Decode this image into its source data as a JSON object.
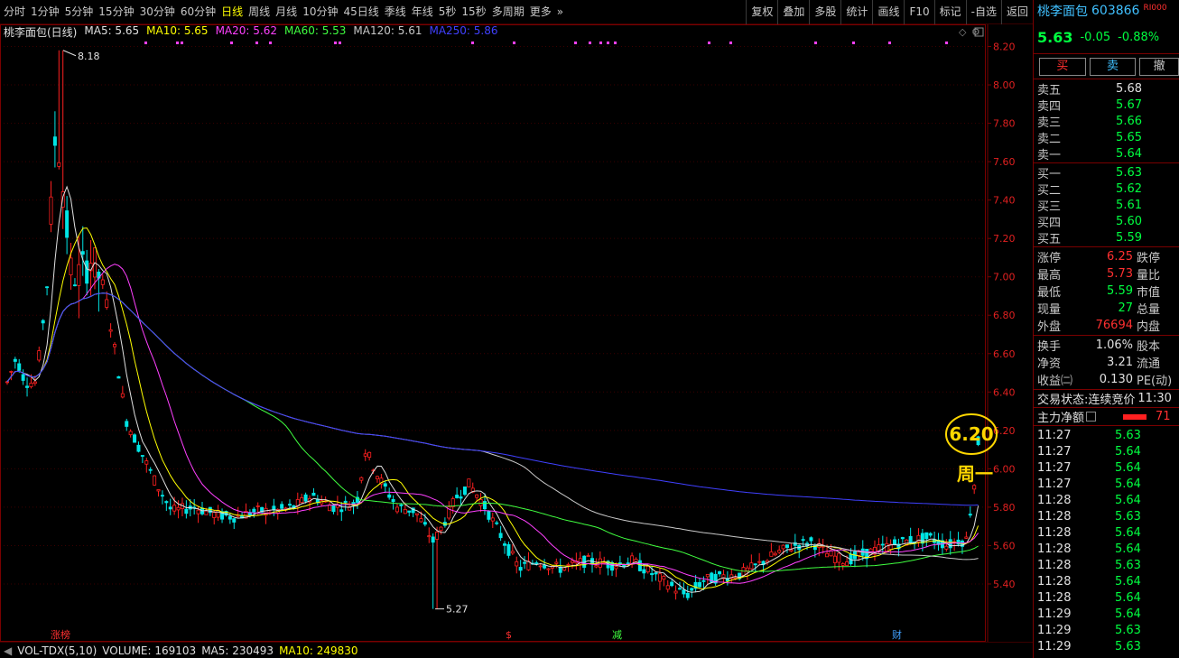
{
  "toolbar": {
    "periods": [
      "分时",
      "1分钟",
      "5分钟",
      "15分钟",
      "30分钟",
      "60分钟",
      "日线",
      "周线",
      "月线",
      "10分钟",
      "45日线",
      "季线",
      "年线",
      "5秒",
      "15秒",
      "多周期",
      "更多"
    ],
    "active_period": "日线",
    "more_arrow": "»",
    "tools": [
      "复权",
      "叠加",
      "多股",
      "统计",
      "画线",
      "F10",
      "标记",
      "-自选",
      "返回"
    ]
  },
  "legend": {
    "stock": "桃李面包(日线)",
    "ma": [
      {
        "label": "MA5: 5.65",
        "color": "#e0e0e0"
      },
      {
        "label": "MA10: 5.65",
        "color": "#ffff00"
      },
      {
        "label": "MA20: 5.62",
        "color": "#ff40ff"
      },
      {
        "label": "MA60: 5.53",
        "color": "#40ff40"
      },
      {
        "label": "MA120: 5.61",
        "color": "#c8c8c8"
      },
      {
        "label": "MA250: 5.86",
        "color": "#4040ff"
      }
    ]
  },
  "chart_data": {
    "type": "candlestick",
    "y_ticks": [
      "8.20",
      "8.00",
      "7.80",
      "7.60",
      "7.40",
      "7.20",
      "7.00",
      "6.80",
      "6.60",
      "6.40",
      "6.20",
      "6.00",
      "5.80",
      "5.60",
      "5.40"
    ],
    "ylim": [
      5.24,
      8.24
    ],
    "high_label": "8.18",
    "low_label": "5.27",
    "event_markers": [
      {
        "label": "涨榜",
        "color": "#ff3030"
      },
      {
        "label": "$",
        "color": "#ff3030"
      },
      {
        "label": "减",
        "color": "#40ff40"
      },
      {
        "label": "财",
        "color": "#40a0ff"
      }
    ],
    "annotation_price": "6.20",
    "annotation_day": "周一",
    "colors": {
      "up": "#ff2020",
      "down": "#00e5e5",
      "ma5": "#e0e0e0",
      "ma10": "#ffff00",
      "ma20": "#ff40ff",
      "ma60": "#40ff40",
      "ma120": "#c8c8c8",
      "ma250": "#4040ff",
      "annotation": "#ffd700"
    }
  },
  "volume": {
    "label": "VOL-TDX(5,10)",
    "volume": "VOLUME: 169103",
    "ma5": "MA5: 230493",
    "ma10": "MA10: 249830",
    "ma10_color": "#ffff00"
  },
  "panel": {
    "name": "桃李面包",
    "code": "603866",
    "level": "RI000",
    "price": "5.63",
    "change": "-0.05",
    "change_pct": "-0.88%",
    "buttons": {
      "buy": "买",
      "sell": "卖",
      "cancel": "撤"
    },
    "asks": [
      {
        "label": "卖五",
        "price": "5.68",
        "color": "white"
      },
      {
        "label": "卖四",
        "price": "5.67",
        "color": "green"
      },
      {
        "label": "卖三",
        "price": "5.66",
        "color": "green"
      },
      {
        "label": "卖二",
        "price": "5.65",
        "color": "green"
      },
      {
        "label": "卖一",
        "price": "5.64",
        "color": "green"
      }
    ],
    "bids": [
      {
        "label": "买一",
        "price": "5.63",
        "color": "green"
      },
      {
        "label": "买二",
        "price": "5.62",
        "color": "green"
      },
      {
        "label": "买三",
        "price": "5.61",
        "color": "green"
      },
      {
        "label": "买四",
        "price": "5.60",
        "color": "green"
      },
      {
        "label": "买五",
        "price": "5.59",
        "color": "green"
      }
    ],
    "stats": [
      {
        "l": "涨停",
        "v": "6.25",
        "c": "red",
        "r": "跌停"
      },
      {
        "l": "最高",
        "v": "5.73",
        "c": "red",
        "r": "量比"
      },
      {
        "l": "最低",
        "v": "5.59",
        "c": "green",
        "r": "市值"
      },
      {
        "l": "现量",
        "v": "27",
        "c": "green",
        "r": "总量"
      },
      {
        "l": "外盘",
        "v": "76694",
        "c": "red",
        "r": "内盘"
      }
    ],
    "stats2": [
      {
        "l": "换手",
        "v": "1.06%",
        "r": "股本"
      },
      {
        "l": "净资",
        "v": "3.21",
        "r": "流通"
      },
      {
        "l": "收益㈡",
        "v": "0.130",
        "r": "PE(动)"
      }
    ],
    "state_label": "交易状态:",
    "state_value": "连续竞价",
    "state_time": "11:30",
    "flow_label": "主力净额",
    "flow_value": "71",
    "ticks": [
      {
        "t": "11:27",
        "p": "5.63"
      },
      {
        "t": "11:27",
        "p": "5.64"
      },
      {
        "t": "11:27",
        "p": "5.64"
      },
      {
        "t": "11:27",
        "p": "5.64"
      },
      {
        "t": "11:28",
        "p": "5.64"
      },
      {
        "t": "11:28",
        "p": "5.63"
      },
      {
        "t": "11:28",
        "p": "5.64"
      },
      {
        "t": "11:28",
        "p": "5.64"
      },
      {
        "t": "11:28",
        "p": "5.63"
      },
      {
        "t": "11:28",
        "p": "5.64"
      },
      {
        "t": "11:28",
        "p": "5.64"
      },
      {
        "t": "11:29",
        "p": "5.64"
      },
      {
        "t": "11:29",
        "p": "5.63"
      },
      {
        "t": "11:29",
        "p": "5.63"
      }
    ]
  }
}
